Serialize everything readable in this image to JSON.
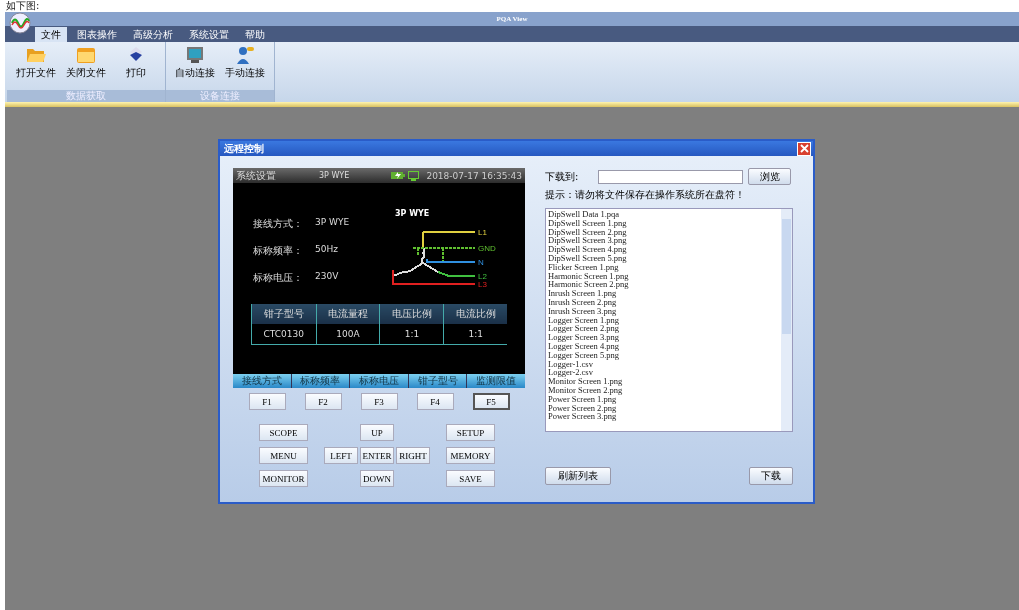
{
  "caption": "如下图:",
  "window": {
    "title": "PQA View"
  },
  "tabs": [
    {
      "label": "文件",
      "selected": true
    },
    {
      "label": "图表操作",
      "selected": false
    },
    {
      "label": "高级分析",
      "selected": false
    },
    {
      "label": "系统设置",
      "selected": false
    },
    {
      "label": "帮助",
      "selected": false
    }
  ],
  "ribbon": [
    {
      "group": "数据获取",
      "buttons": [
        {
          "label": "打开文件",
          "kind": "open"
        },
        {
          "label": "关闭文件",
          "kind": "close"
        },
        {
          "label": "打印",
          "kind": "print"
        }
      ]
    },
    {
      "group": "设备连接",
      "buttons": [
        {
          "label": "自动连接",
          "kind": "auto"
        },
        {
          "label": "手动连接",
          "kind": "manual"
        }
      ]
    }
  ],
  "dialog": {
    "title": "远程控制",
    "screen": {
      "title": "系统设置",
      "mode": "3P WYE",
      "datetime": "2018-07-17 16:35:43",
      "params": [
        {
          "label": "接线方式：",
          "value": "3P WYE"
        },
        {
          "label": "标称频率：",
          "value": "50Hz"
        },
        {
          "label": "标称电压：",
          "value": "230V"
        }
      ],
      "diagram": {
        "title": "3P WYE",
        "lines": [
          {
            "label": "L1",
            "color": "#e0d040"
          },
          {
            "label": "GND",
            "color": "#60c030"
          },
          {
            "label": "N",
            "color": "#3090e0"
          },
          {
            "label": "L2",
            "color": "#40c040"
          },
          {
            "label": "L3",
            "color": "#e02020"
          }
        ]
      },
      "table": {
        "columns": [
          "钳子型号",
          "电流量程",
          "电压比例",
          "电流比例"
        ],
        "rows": [
          [
            "CTC0130",
            "100A",
            "1:1",
            "1:1"
          ]
        ]
      },
      "softkeys": [
        "接线方式",
        "标称频率",
        "标称电压",
        "钳子型号",
        "监测限值"
      ]
    },
    "fkeys": [
      {
        "label": "F1",
        "selected": false
      },
      {
        "label": "F2",
        "selected": false
      },
      {
        "label": "F3",
        "selected": false
      },
      {
        "label": "F4",
        "selected": false
      },
      {
        "label": "F5",
        "selected": true
      }
    ],
    "controls": [
      {
        "left": "SCOPE",
        "middle": [
          "UP"
        ],
        "right": "SETUP"
      },
      {
        "left": "MENU",
        "middle": [
          "LEFT",
          "ENTER",
          "RIGHT"
        ],
        "right": "MEMORY"
      },
      {
        "left": "MONITOR",
        "middle": [
          "DOWN"
        ],
        "right": "SAVE"
      }
    ],
    "download_label": "下载到:",
    "browse": "浏览",
    "hint": "提示：请勿将文件保存在操作系统所在盘符！",
    "files": [
      "DipSwell Data 1.pqa",
      "DipSwell Screen 1.png",
      "DipSwell Screen 2.png",
      "DipSwell Screen 3.png",
      "DipSwell Screen 4.png",
      "DipSwell Screen 5.png",
      "Flicker Screen 1.png",
      "Harmonic Screen 1.png",
      "Harmonic Screen 2.png",
      "Inrush Screen 1.png",
      "Inrush Screen 2.png",
      "Inrush Screen 3.png",
      "Logger Screen 1.png",
      "Logger Screen 2.png",
      "Logger Screen 3.png",
      "Logger Screen 4.png",
      "Logger Screen 5.png",
      "Logger-1.csv",
      "Logger-2.csv",
      "Monitor Screen 1.png",
      "Monitor Screen 2.png",
      "Power Screen 1.png",
      "Power Screen 2.png",
      "Power Screen 3.png"
    ],
    "refresh": "刷新列表",
    "download": "下载"
  }
}
